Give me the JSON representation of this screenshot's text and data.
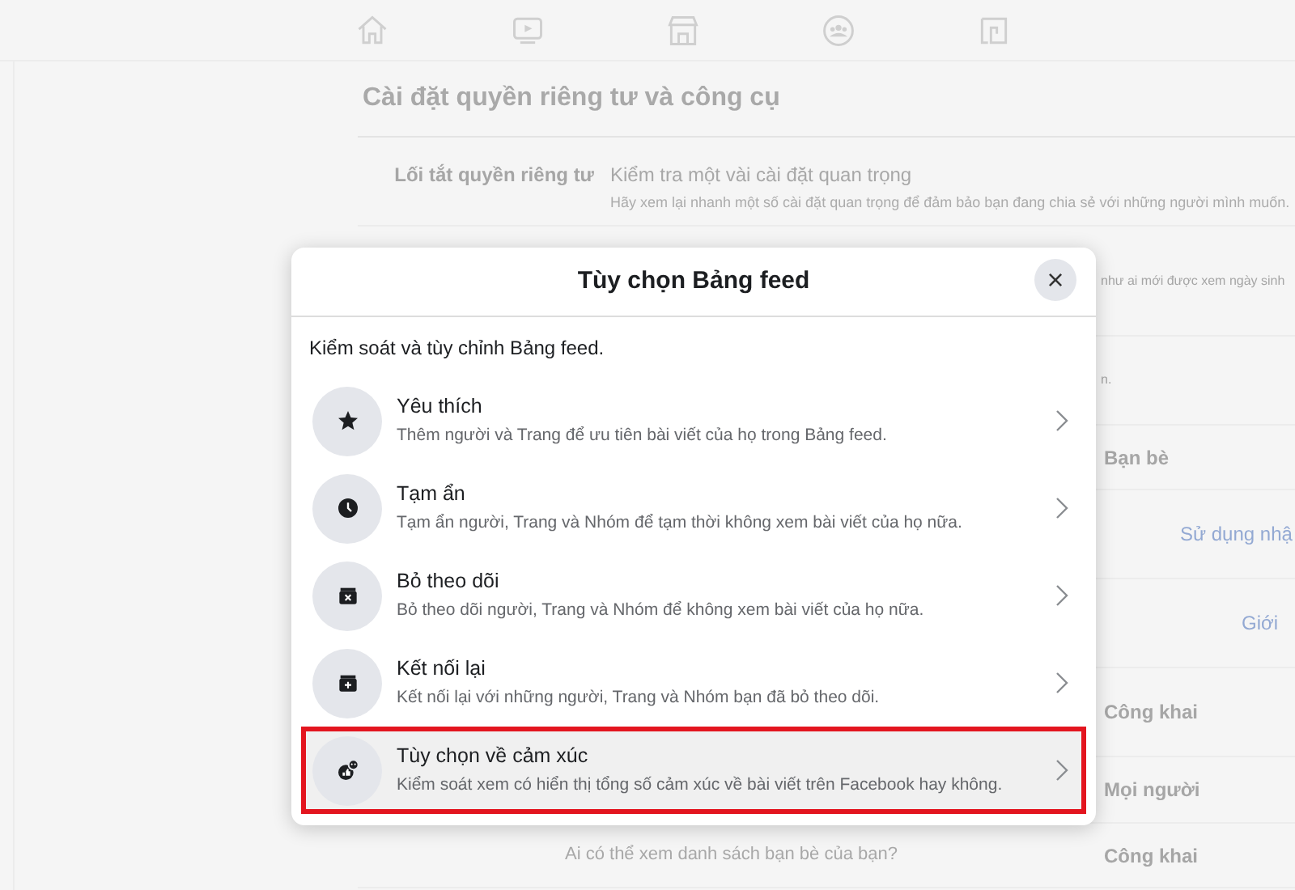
{
  "page": {
    "title": "Cài đặt quyền riêng tư và công cụ",
    "rows": [
      {
        "label": "Lối tắt quyền riêng tư",
        "heading": "Kiểm tra một vài cài đặt quan trọng",
        "description": "Hãy xem lại nhanh một số cài đặt quan trọng để đảm bảo bạn đang chia sẻ với những người mình muốn."
      },
      {
        "value": "như ai mới được xem ngày sinh"
      },
      {
        "value": "n."
      },
      {
        "value": "Bạn bè"
      },
      {
        "link": "Sử dụng nhậ"
      },
      {
        "link": "Giới"
      },
      {
        "value": "Công khai"
      },
      {
        "value": "Mọi người"
      },
      {
        "question": "Ai có thể xem danh sách bạn bè của bạn?",
        "value": "Công khai"
      }
    ]
  },
  "dialog": {
    "title": "Tùy chọn Bảng feed",
    "close": "×",
    "subtitle": "Kiểm soát và tùy chỉnh Bảng feed.",
    "items": [
      {
        "title": "Yêu thích",
        "description": "Thêm người và Trang để ưu tiên bài viết của họ trong Bảng feed.",
        "selected": false
      },
      {
        "title": "Tạm ẩn",
        "description": "Tạm ẩn người, Trang và Nhóm để tạm thời không xem bài viết của họ nữa.",
        "selected": false
      },
      {
        "title": "Bỏ theo dõi",
        "description": "Bỏ theo dõi người, Trang và Nhóm để không xem bài viết của họ nữa.",
        "selected": false
      },
      {
        "title": "Kết nối lại",
        "description": "Kết nối lại với những người, Trang và Nhóm bạn đã bỏ theo dõi.",
        "selected": false
      },
      {
        "title": "Tùy chọn về cảm xúc",
        "description": "Kiểm soát xem có hiển thị tổng số cảm xúc về bài viết trên Facebook hay không.",
        "selected": true
      }
    ]
  }
}
